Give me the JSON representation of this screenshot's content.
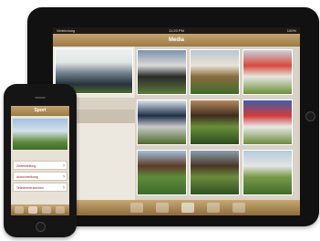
{
  "ipad": {
    "status": {
      "carrier": "Verbindung",
      "time": "11:20 PM",
      "battery": "100%"
    },
    "nav_title": "Media",
    "photos": [
      {
        "id": "p1",
        "colors": [
          "#7c93ad",
          "#d8d9d6",
          "#2a2a2a",
          "#5d7a3a"
        ]
      },
      {
        "id": "p2",
        "colors": [
          "#b9c5cf",
          "#e8e3d6",
          "#8a6b3e",
          "#3e6b2a"
        ]
      },
      {
        "id": "p3",
        "colors": [
          "#c9d3db",
          "#d64a3e",
          "#e7e7e2",
          "#6a8f3a"
        ]
      },
      {
        "id": "p4",
        "colors": [
          "#d9e4ec",
          "#1e2f48",
          "#c9c9c9",
          "#4c6b2a"
        ]
      },
      {
        "id": "p5",
        "colors": [
          "#b58a5e",
          "#3f2c1e",
          "#6a8f3a",
          "#2b4a1e"
        ]
      },
      {
        "id": "p6",
        "colors": [
          "#3c5ea8",
          "#d23b3b",
          "#e8e8e8",
          "#6d8b3c"
        ]
      },
      {
        "id": "p7",
        "colors": [
          "#a7c1d8",
          "#5e3a2a",
          "#5f8a3c",
          "#3d6b2a"
        ]
      },
      {
        "id": "p8",
        "colors": [
          "#8aa0b2",
          "#4a3626",
          "#6d8b3c",
          "#2e4f22"
        ]
      },
      {
        "id": "p9",
        "colors": [
          "#b6cada",
          "#e4e4e4",
          "#7a9a4a",
          "#3f6b2a"
        ]
      },
      {
        "id": "p10",
        "colors": [
          "#c8d6e3",
          "#d9d9d9",
          "#6f8f44",
          "#3a6228"
        ]
      }
    ]
  },
  "iphone": {
    "nav_title": "Sport",
    "menu": [
      {
        "label": "Zeiteinteilung"
      },
      {
        "label": "Ausschreibung"
      },
      {
        "label": "Teilnehmerzeichen"
      }
    ]
  }
}
